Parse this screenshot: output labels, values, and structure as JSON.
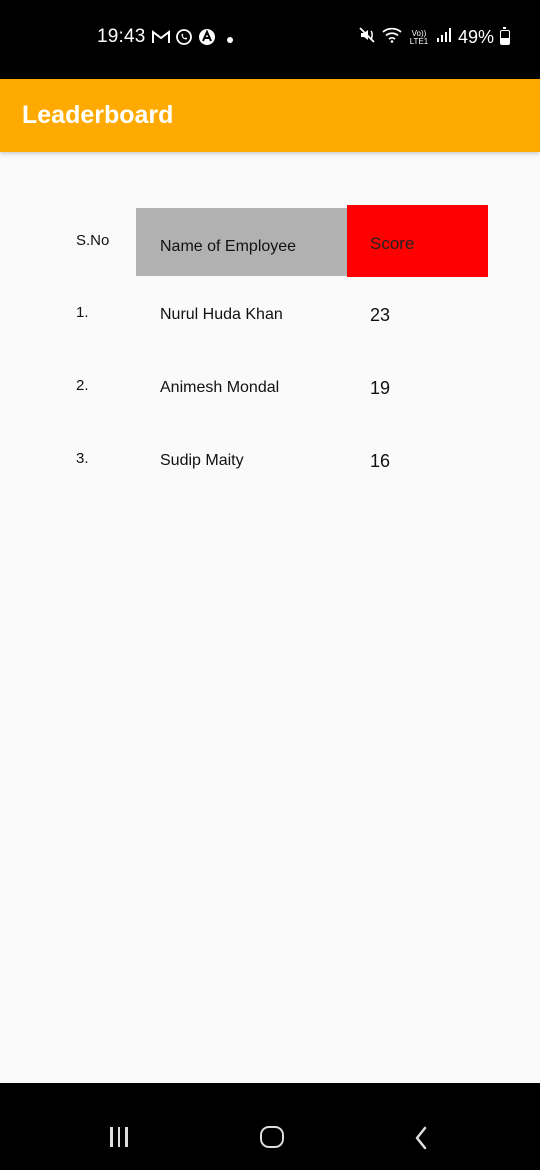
{
  "status_bar": {
    "time": "19:43",
    "left_icons": [
      "gmail-icon",
      "whatsapp-icon",
      "arc-app-icon",
      "notification-dot"
    ],
    "right_icons": [
      "mute-icon",
      "wifi-icon",
      "volte-lte-icon",
      "signal-icon"
    ],
    "network_label": "Vo)) LTE1",
    "battery": "49%"
  },
  "app_bar": {
    "title": "Leaderboard",
    "color": "#ffaa00"
  },
  "table": {
    "headers": {
      "sno": "S.No",
      "name": "Name of Employee",
      "score": "Score"
    },
    "header_colors": {
      "name_bg": "#b1b1b1",
      "score_bg": "#ff0000"
    },
    "rows": [
      {
        "sno": "1.",
        "name": "Nurul Huda Khan",
        "score": "23"
      },
      {
        "sno": "2.",
        "name": "Animesh Mondal",
        "score": "19"
      },
      {
        "sno": "3.",
        "name": "Sudip Maity",
        "score": "16"
      }
    ]
  },
  "nav_bar": {
    "buttons": [
      "recents-icon",
      "home-icon",
      "back-icon"
    ]
  }
}
